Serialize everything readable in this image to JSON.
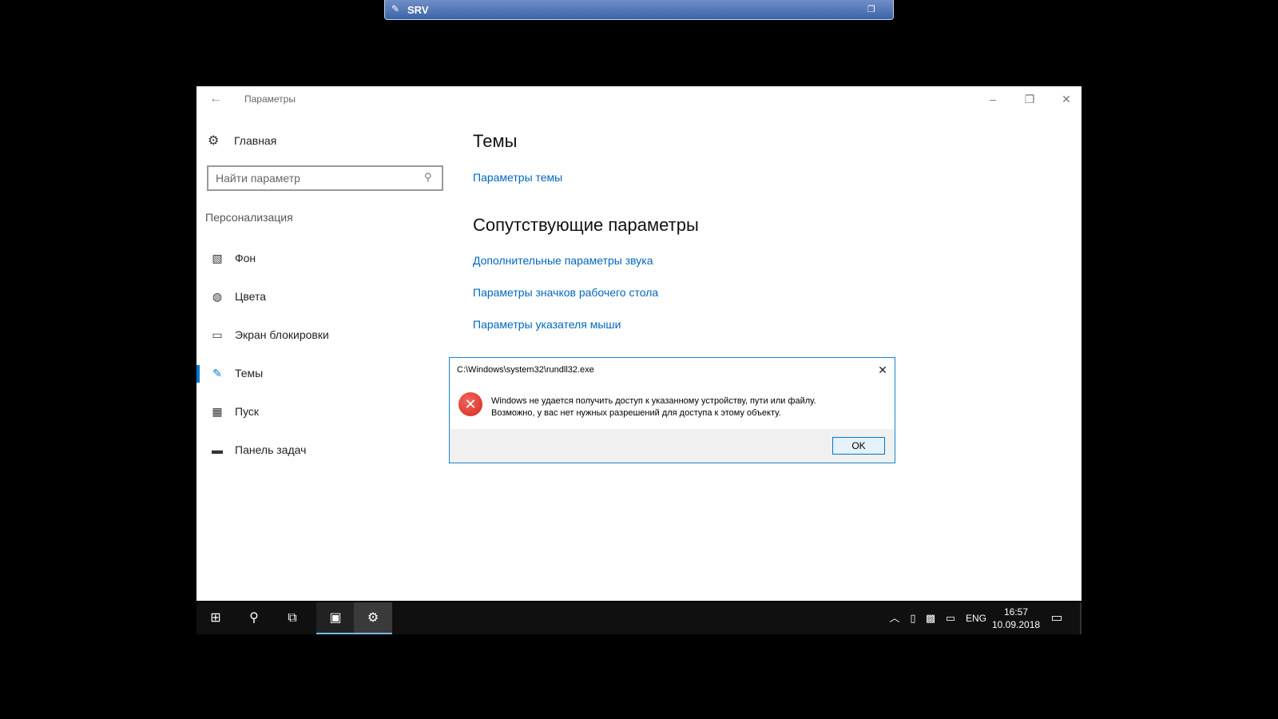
{
  "rdp": {
    "host": "SRV"
  },
  "window": {
    "title": "Параметры",
    "nav": {
      "home_label": "Главная",
      "search_placeholder": "Найти параметр",
      "section_label": "Персонализация",
      "items": [
        {
          "label": "Фон",
          "icon": "image-icon",
          "active": false
        },
        {
          "label": "Цвета",
          "icon": "palette-icon",
          "active": false
        },
        {
          "label": "Экран блокировки",
          "icon": "lock-screen-icon",
          "active": false
        },
        {
          "label": "Темы",
          "icon": "themes-icon",
          "active": true
        },
        {
          "label": "Пуск",
          "icon": "start-icon",
          "active": false
        },
        {
          "label": "Панель задач",
          "icon": "taskbar-icon",
          "active": false
        }
      ]
    },
    "content": {
      "heading": "Темы",
      "theme_link": "Параметры темы",
      "related_heading": "Сопутствующие параметры",
      "related_links": [
        "Дополнительные параметры звука",
        "Параметры значков рабочего стола",
        "Параметры указателя мыши"
      ]
    }
  },
  "dialog": {
    "title": "C:\\Windows\\system32\\rundll32.exe",
    "message_line1": "Windows не удается получить доступ к указанному устройству, пути или файлу.",
    "message_line2": "Возможно, у вас нет нужных разрешений для доступа к этому объекту.",
    "ok_label": "OK",
    "icon": "error-icon"
  },
  "taskbar": {
    "language": "ENG",
    "time": "16:57",
    "date": "10.09.2018"
  }
}
